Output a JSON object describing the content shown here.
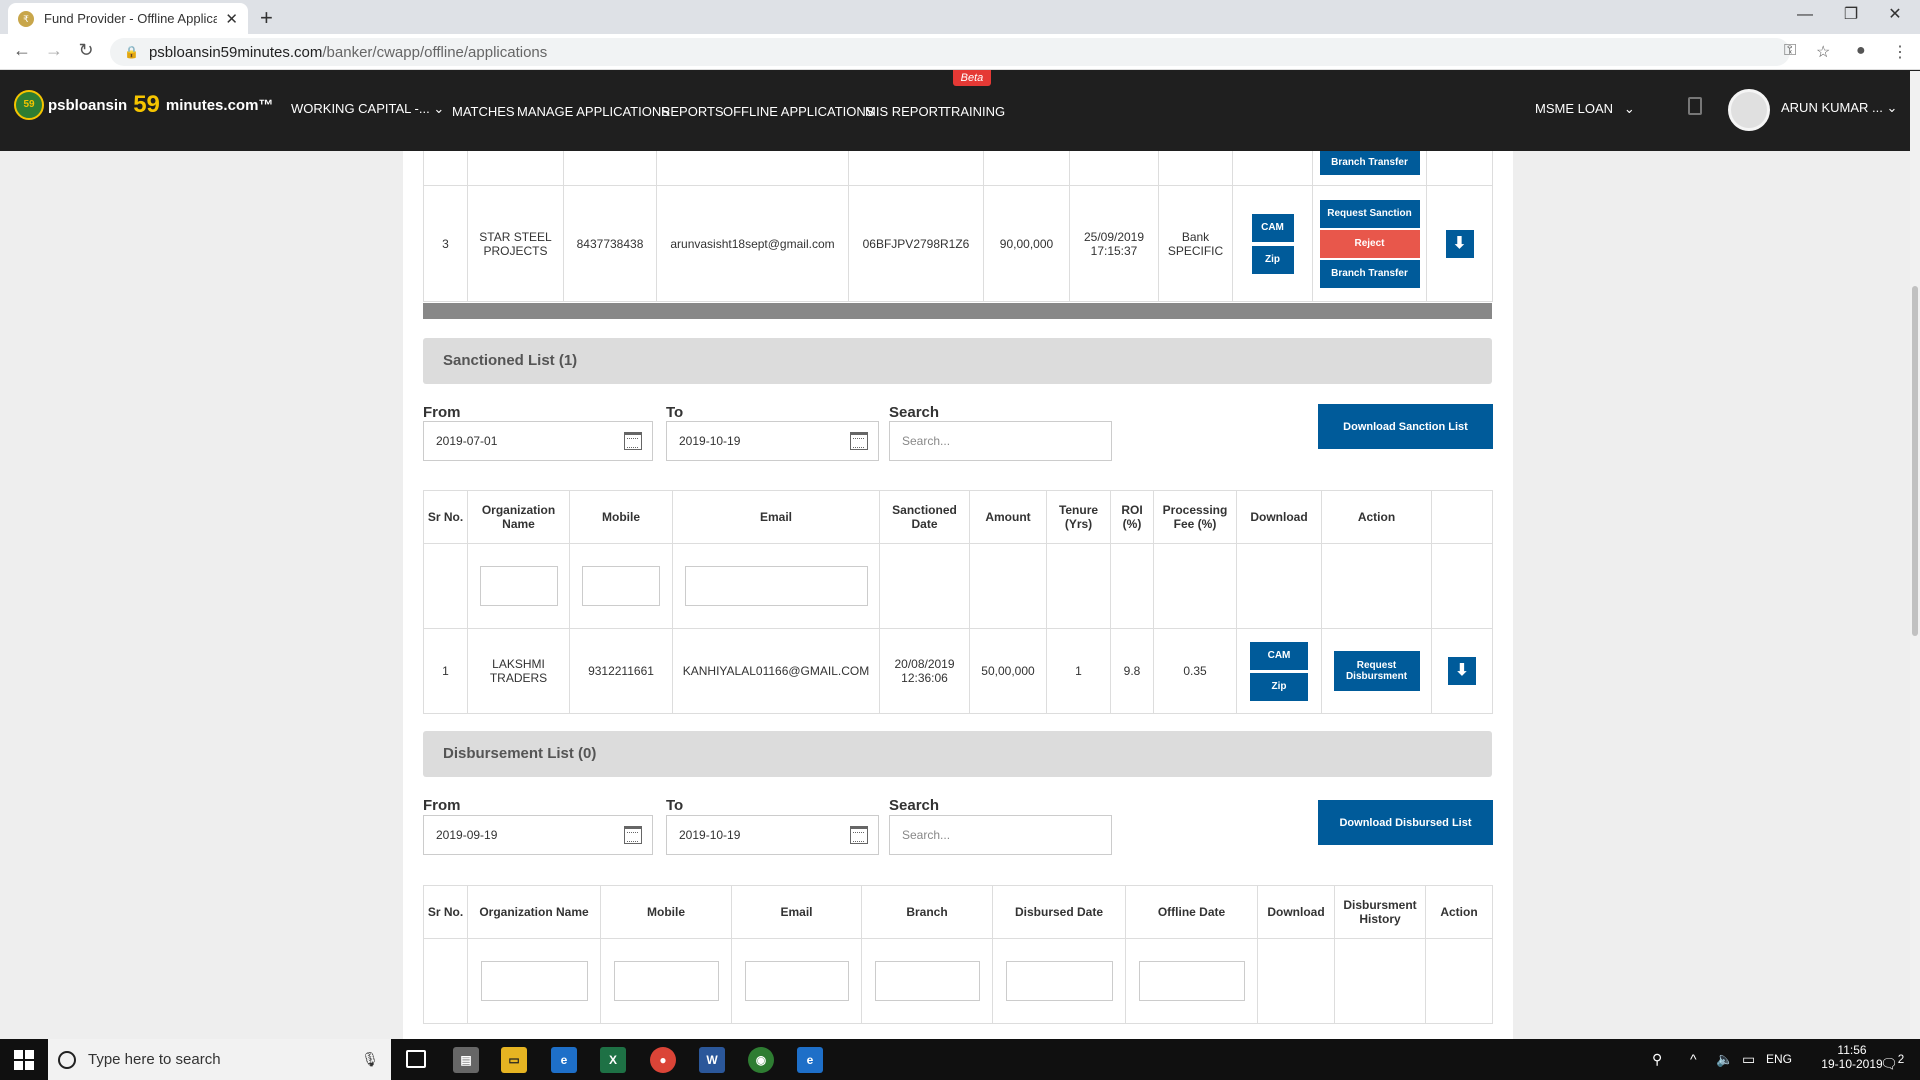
{
  "browser": {
    "tab_title": "Fund Provider - Offline Applicatio",
    "url_host": "psbloansin59minutes.com",
    "url_path": "/banker/cwapp/offline/applications"
  },
  "header": {
    "logo_part1": "psbloansin",
    "logo_part2": "59",
    "logo_part3": "minutes.com™",
    "logo_badge": "59",
    "working_capital": "WORKING CAPITAL -...",
    "menu": [
      "MATCHES",
      "MANAGE APPLICATIONS",
      "REPORTS",
      "OFFLINE APPLICATIONS",
      "MIS REPORT",
      "TRAINING"
    ],
    "beta_badge": "Beta",
    "loan_type": "MSME LOAN",
    "user_name": "ARUN KUMAR ..."
  },
  "top_table": {
    "prev_row_branch_transfer": "Branch Transfer",
    "row": {
      "sr": "3",
      "org": "STAR STEEL PROJECTS",
      "mobile": "8437738438",
      "email": "arunvasisht18sept@gmail.com",
      "gstin": "06BFJPV2798R1Z6",
      "amount": "90,00,000",
      "date": "25/09/2019 17:15:37",
      "type": "Bank SPECIFIC",
      "cam": "CAM",
      "zip": "Zip",
      "request_sanction": "Request Sanction",
      "reject": "Reject",
      "branch_transfer": "Branch Transfer"
    }
  },
  "sanctioned": {
    "title": "Sanctioned List (1)",
    "from_label": "From",
    "from_value": "2019-07-01",
    "to_label": "To",
    "to_value": "2019-10-19",
    "search_label": "Search",
    "search_placeholder": "Search...",
    "download_button": "Download Sanction List",
    "columns": [
      "Sr No.",
      "Organization Name",
      "Mobile",
      "Email",
      "Sanctioned Date",
      "Amount",
      "Tenure (Yrs)",
      "ROI (%)",
      "Processing Fee (%)",
      "Download",
      "Action",
      ""
    ],
    "row": {
      "sr": "1",
      "org": "LAKSHMI TRADERS",
      "mobile": "9312211661",
      "email": "KANHIYALAL01166@GMAIL.COM",
      "date": "20/08/2019 12:36:06",
      "amount": "50,00,000",
      "tenure": "1",
      "roi": "9.8",
      "fee": "0.35",
      "cam": "CAM",
      "zip": "Zip",
      "action": "Request Disbursment"
    }
  },
  "disbursement": {
    "title": "Disbursement List (0)",
    "from_label": "From",
    "from_value": "2019-09-19",
    "to_label": "To",
    "to_value": "2019-10-19",
    "search_label": "Search",
    "search_placeholder": "Search...",
    "download_button": "Download Disbursed List",
    "columns": [
      "Sr No.",
      "Organization Name",
      "Mobile",
      "Email",
      "Branch",
      "Disbursed Date",
      "Offline Date",
      "Download",
      "Disbursment History",
      "Action"
    ]
  },
  "taskbar": {
    "search_placeholder": "Type here to search",
    "language": "ENG",
    "time": "11:56",
    "date": "19-10-2019",
    "notif_count": "2"
  },
  "colors": {
    "primary_button": "#005b9a",
    "reject_button": "#e8574b",
    "header_bg": "#1f1f1f",
    "beta": "#e53935"
  }
}
